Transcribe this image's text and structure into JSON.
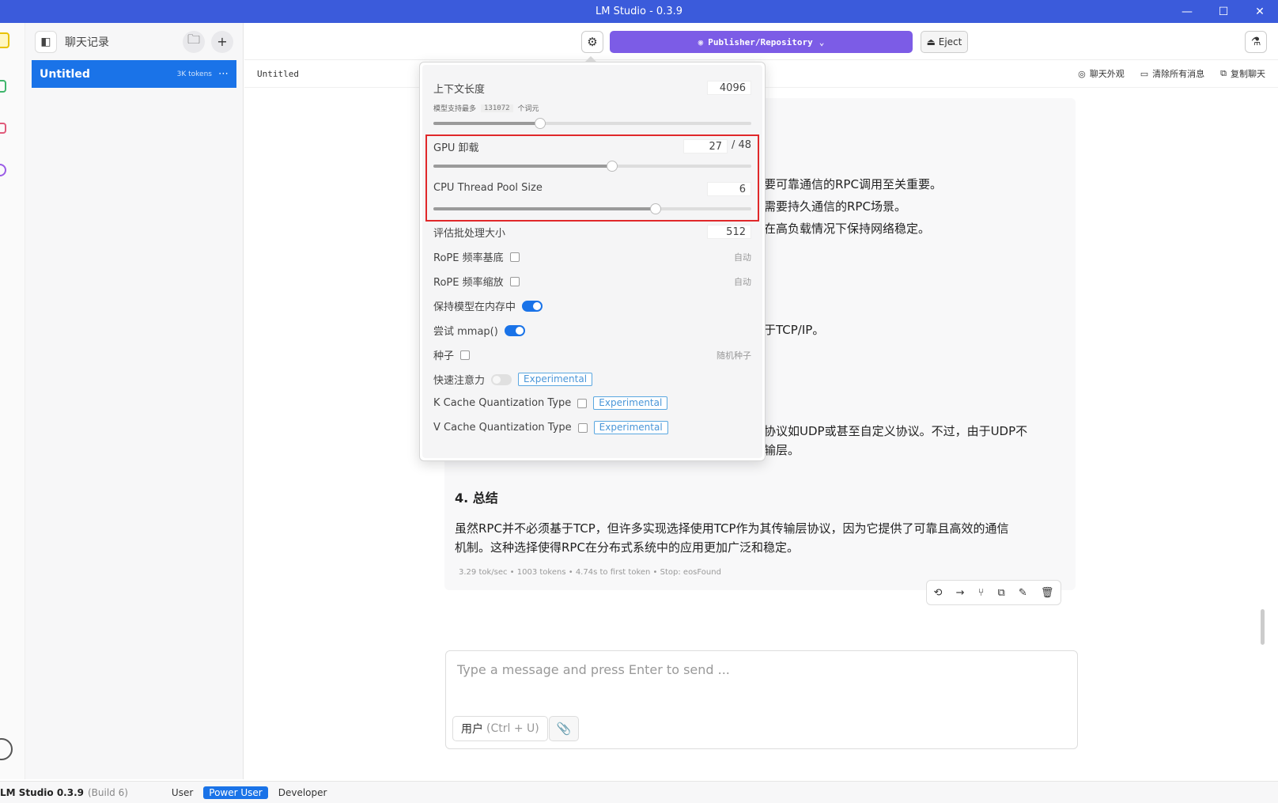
{
  "window": {
    "title": "LM Studio - 0.3.9",
    "minimize": "—",
    "maximize": "☐",
    "close": "✕"
  },
  "sidebar": {
    "title": "聊天记录",
    "chats": [
      {
        "name": "Untitled",
        "tokens": "3K tokens",
        "more": "⋯"
      }
    ]
  },
  "toolbar": {
    "model_label": "Publisher/Repository",
    "eject_label": "⏏ Eject"
  },
  "chat": {
    "title": "Untitled",
    "actions": {
      "appearance": "聊天外观",
      "clear": "清除所有消息",
      "copy": "复制聊天"
    },
    "fragments": [
      "要可靠通信的RPC调用至关重要。",
      "需要持久通信的RPC场景。",
      "在高负载情况下保持网络稳定。",
      "于TCP/IP。",
      "协议如UDP或甚至自定义协议。不过，由于UDP不",
      "输层。"
    ],
    "heading": "4. 总结",
    "summary_line1": "虽然RPC并不必须基于TCP，但许多实现选择使用TCP作为其传输层协议，因为它提供了可靠且高效的通信",
    "summary_line2": "机制。这种选择使得RPC在分布式系统中的应用更加广泛和稳定。",
    "stats": "3.29 tok/sec • 1003 tokens • 4.74s to first token • Stop: eosFound"
  },
  "input": {
    "placeholder": "Type a message and press Enter to send ...",
    "role_label": "用户",
    "role_shortcut": "(Ctrl + U)"
  },
  "settings": {
    "context_length": {
      "label": "上下文长度",
      "value": "4096",
      "sub_prefix": "模型支持最多",
      "sub_value": "131072",
      "sub_suffix": "个词元",
      "fraction": 0.335
    },
    "gpu_offload": {
      "label": "GPU 卸载",
      "value": "27",
      "max": "/ 48",
      "fraction": 0.5625
    },
    "cpu_threads": {
      "label": "CPU Thread Pool Size",
      "value": "6",
      "fraction": 0.7
    },
    "eval_batch": {
      "label": "评估批处理大小",
      "value": "512"
    },
    "rope_base": {
      "label": "RoPE 频率基底",
      "right": "自动"
    },
    "rope_scale": {
      "label": "RoPE 频率缩放",
      "right": "自动"
    },
    "keep_in_memory": {
      "label": "保持模型在内存中"
    },
    "try_mmap": {
      "label": "尝试 mmap()"
    },
    "seed": {
      "label": "种子",
      "right": "随机种子"
    },
    "flash_attention": {
      "label": "快速注意力",
      "badge": "Experimental"
    },
    "k_cache": {
      "label": "K Cache Quantization Type",
      "badge": "Experimental"
    },
    "v_cache": {
      "label": "V Cache Quantization Type",
      "badge": "Experimental"
    }
  },
  "statusbar": {
    "version": "LM Studio 0.3.9",
    "build": "(Build 6)",
    "modes": [
      "User",
      "Power User",
      "Developer"
    ],
    "active_mode": "Power User"
  },
  "colors": {
    "titlebar": "#3b5bdb",
    "accent": "#1a73e8",
    "model_button": "#7c5ce6",
    "highlight": "#e0282a"
  }
}
